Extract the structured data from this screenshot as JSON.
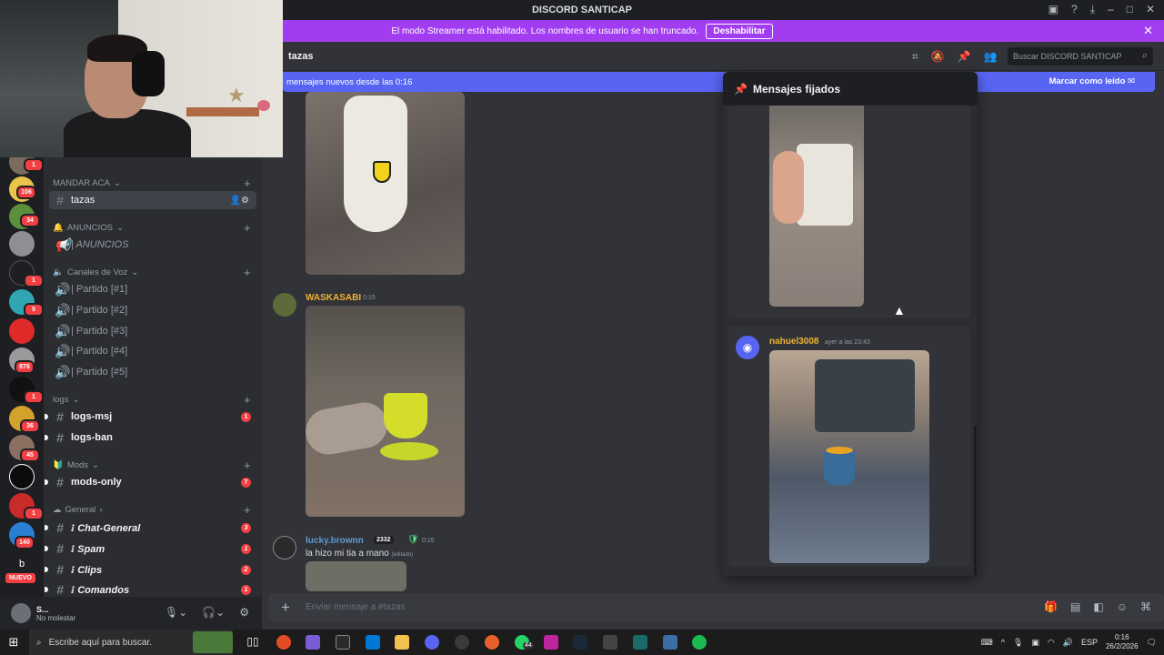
{
  "window": {
    "title": "DISCORD SANTICAP",
    "controls": [
      "minimize",
      "maximize",
      "close"
    ]
  },
  "streamer_banner": {
    "text": "El modo Streamer está habilitado. Los nombres de usuario se han truncado.",
    "button": "Deshabilitar"
  },
  "servers": [
    {
      "badge": "1"
    },
    {
      "badge": "106"
    },
    {
      "badge": "34"
    },
    {
      "badge": ""
    },
    {
      "badge": "1"
    },
    {
      "badge": "5"
    },
    {
      "badge": ""
    },
    {
      "badge": "876"
    },
    {
      "badge": "1"
    },
    {
      "badge": "36"
    },
    {
      "badge": "45"
    },
    {
      "badge": ""
    },
    {
      "badge": "1"
    },
    {
      "badge": "140"
    },
    {
      "badge": ""
    }
  ],
  "new_badge": "NUEVO",
  "sidebar": {
    "categories": {
      "mandar": "MANDAR ACA",
      "anuncios": "ANUNCIOS",
      "voz": "Canales de Voz",
      "logs": "logs",
      "mods": "Mods",
      "general": "General"
    },
    "channels": {
      "tazas": "tazas",
      "anuncios": "| ANUNCIOS",
      "partido1": "| Partido [#1]",
      "partido2": "| Partido [#2]",
      "partido3": "| Partido [#3]",
      "partido4": "| Partido [#4]",
      "partido5": "| Partido [#5]",
      "logs_msj": "logs-msj",
      "logs_msj_count": "1",
      "logs_ban": "logs-ban",
      "mods_only": "mods-only",
      "mods_only_count": "7",
      "chat_general": "⁝ Chat-General",
      "chat_general_count": "3",
      "spam": "⁝ Spam",
      "spam_count": "1",
      "clips": "⁝ Clips",
      "clips_count": "2",
      "comandos": "⁝ Comandos",
      "comandos_count": "1"
    }
  },
  "user_panel": {
    "name": "S...",
    "status": "No molestar"
  },
  "channel_header": {
    "name": "tazas",
    "search_placeholder": "Buscar DISCORD SANTICAP"
  },
  "new_messages_bar": {
    "text": "mensajes nuevos desde las 0:16",
    "action": "Marcar como leído"
  },
  "messages": [
    {
      "author": "WASKASABI",
      "time": "0:15",
      "author_color": "#f0b232"
    },
    {
      "author": "lucky.brownn",
      "tag": "2332",
      "time": "0:15",
      "text": "la hizo mi tia a mano",
      "edited": "(editado)",
      "author_color": "#5b9bd5"
    }
  ],
  "pinned_panel": {
    "title": "Mensajes fijados",
    "message": {
      "author": "nahuel3008",
      "time": "ayer a las 23:43",
      "author_color": "#f0b232"
    }
  },
  "composer": {
    "placeholder": "Enviar mensaje a #tazas"
  },
  "taskbar": {
    "search_placeholder": "Escribe aquí para buscar.",
    "whatsapp_badge": "44",
    "language": "ESP",
    "time": "0:16",
    "date": "26/2/2026"
  }
}
